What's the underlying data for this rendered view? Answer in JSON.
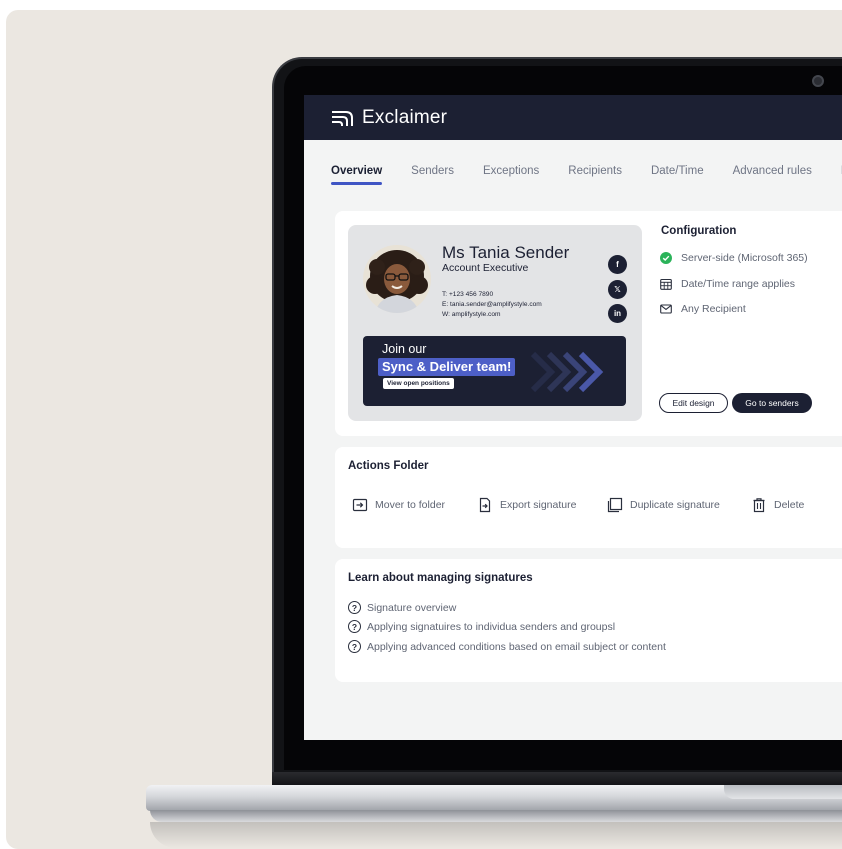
{
  "app": {
    "title": "Exclaimer"
  },
  "tabs": [
    {
      "label": "Overview",
      "active": true
    },
    {
      "label": "Senders",
      "active": false
    },
    {
      "label": "Exceptions",
      "active": false
    },
    {
      "label": "Recipients",
      "active": false
    },
    {
      "label": "Date/Time",
      "active": false
    },
    {
      "label": "Advanced rules",
      "active": false
    },
    {
      "label": "E",
      "active": false
    }
  ],
  "signature_preview": {
    "name": "Ms Tania Sender",
    "role": "Account Executive",
    "phone": "T: +123 456 7890",
    "email": "E: tania.sender@amplifystyle.com",
    "website": "W: amplifystyle.com",
    "social_icons": [
      "facebook-icon",
      "x-icon",
      "linkedin-icon"
    ],
    "banner": {
      "line1": "Join our",
      "line2": "Sync & Deliver team!",
      "button": "View open positions"
    }
  },
  "configuration": {
    "title": "Configuration",
    "items": [
      {
        "icon": "check-circle-icon",
        "label": "Server-side (Microsoft 365)"
      },
      {
        "icon": "calendar-icon",
        "label": "Date/Time range applies"
      },
      {
        "icon": "envelope-icon",
        "label": "Any Recipient"
      }
    ],
    "edit_button": "Edit design",
    "senders_button": "Go to senders"
  },
  "actions_folder": {
    "title": "Actions Folder",
    "items": [
      {
        "icon": "move-folder-icon",
        "label": "Mover to folder"
      },
      {
        "icon": "export-icon",
        "label": "Export signature"
      },
      {
        "icon": "duplicate-icon",
        "label": "Duplicate signature"
      },
      {
        "icon": "trash-icon",
        "label": "Delete"
      }
    ]
  },
  "learn": {
    "title": "Learn about managing signatures",
    "links": [
      "Signature overview",
      "Applying signatuires to individua senders and groupsl",
      "Applying advanced conditions based on email subject or content"
    ]
  },
  "colors": {
    "navy": "#1c2033",
    "accent": "#3f55c4",
    "success": "#2bb35a",
    "backdrop": "#ebe7e1"
  }
}
